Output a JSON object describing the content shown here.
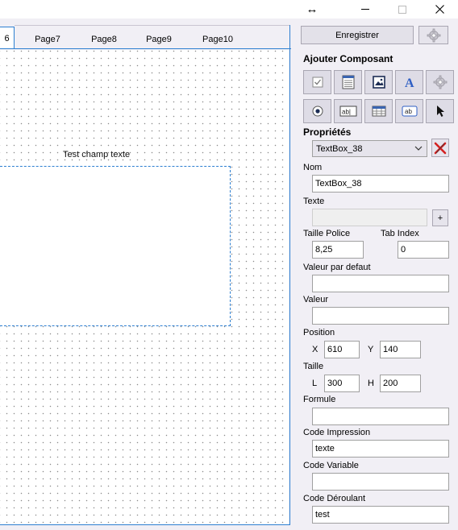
{
  "window": {
    "resize_glyph": "↔"
  },
  "tabs": [
    {
      "label": "6",
      "active": true
    },
    {
      "label": "Page7"
    },
    {
      "label": "Page8"
    },
    {
      "label": "Page9"
    },
    {
      "label": "Page10"
    }
  ],
  "canvas": {
    "field_label": "Test champ texte"
  },
  "panel": {
    "save_label": "Enregistrer",
    "add_component_title": "Ajouter Composant",
    "properties_title": "Propriétés",
    "selected_component": "TextBox_38",
    "nom_label": "Nom",
    "nom_value": "TextBox_38",
    "texte_label": "Texte",
    "texte_value": "",
    "plus_label": "+",
    "taille_police_label": "Taille Police",
    "taille_police_value": "8,25",
    "tab_index_label": "Tab Index",
    "tab_index_value": "0",
    "valeur_defaut_label": "Valeur par defaut",
    "valeur_defaut_value": "",
    "valeur_label": "Valeur",
    "valeur_value": "",
    "position_label": "Position",
    "x_label": "X",
    "x_value": "610",
    "y_label": "Y",
    "y_value": "140",
    "taille_label": "Taille",
    "l_label": "L",
    "l_value": "300",
    "h_label": "H",
    "h_value": "200",
    "formule_label": "Formule",
    "formule_value": "",
    "code_impression_label": "Code Impression",
    "code_impression_value": "texte",
    "code_variable_label": "Code Variable",
    "code_variable_value": "",
    "code_deroulant_label": "Code Déroulant",
    "code_deroulant_value": "test"
  },
  "toolbox": [
    "checkbox-tool-icon",
    "list-tool-icon",
    "image-tool-icon",
    "label-tool-icon",
    "settings-tool-icon",
    "radio-tool-icon",
    "textbox-tool-icon",
    "table-tool-icon",
    "button-tool-icon",
    "pointer-tool-icon"
  ],
  "colors": {
    "accent": "#2d7fd1",
    "panel_bg": "#f1eff5",
    "delete_red": "#d42020"
  }
}
